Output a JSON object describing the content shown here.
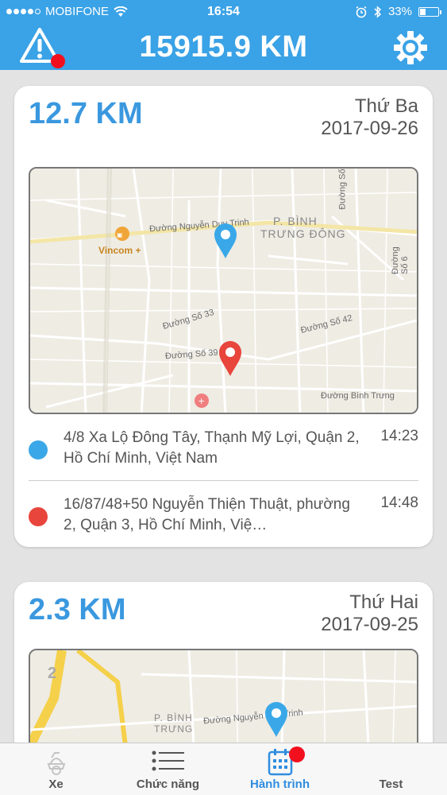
{
  "status_bar": {
    "carrier": "MOBIFONE",
    "time": "16:54",
    "battery": "33%",
    "battery_level": 0.33
  },
  "header": {
    "title": "15915.9 KM"
  },
  "trips": [
    {
      "distance": "12.7 KM",
      "weekday": "Thứ Ba",
      "date": "2017-09-26",
      "map_labels": {
        "street1": "Đường Nguyễn Duy Trinh",
        "district": "P. BÌNH",
        "district2": "TRƯNG ĐÔNG",
        "poi": "Vincom +",
        "street2": "Đường Số 33",
        "street3": "Đường Số 39",
        "street4": "Đường Số 42",
        "street5": "Đường Bình Trưng",
        "street6": "Đường Số 6",
        "street7": "Đường Số"
      },
      "stops": [
        {
          "address": "4/8 Xa Lộ Đông Tây, Thạnh Mỹ Lợi, Quận 2, Hồ Chí Minh, Việt Nam",
          "time": "14:23",
          "color": "#3aa8e8"
        },
        {
          "address": "16/87/48+50 Nguyễn Thiện Thuật, phường 2, Quận 3, Hồ Chí Minh, Việ…",
          "time": "14:48",
          "color": "#e8453c"
        }
      ]
    },
    {
      "distance": "2.3 KM",
      "weekday": "Thứ Hai",
      "date": "2017-09-25",
      "map_labels": {
        "district": "P. BÌNH",
        "district2": "TRƯNG",
        "street1": "Đường Nguyễn Duy Trinh",
        "number": "2"
      }
    }
  ],
  "tabs": [
    {
      "label": "Xe",
      "icon": "scooter-icon"
    },
    {
      "label": "Chức năng",
      "icon": "list-icon"
    },
    {
      "label": "Hành trình",
      "icon": "calendar-icon",
      "active": true
    },
    {
      "label": "Test",
      "icon": "blank-icon"
    }
  ],
  "colors": {
    "accent": "#3aa2e6",
    "badge": "#f2101f",
    "start_pin": "#3aa8e8",
    "end_pin": "#e8453c"
  }
}
